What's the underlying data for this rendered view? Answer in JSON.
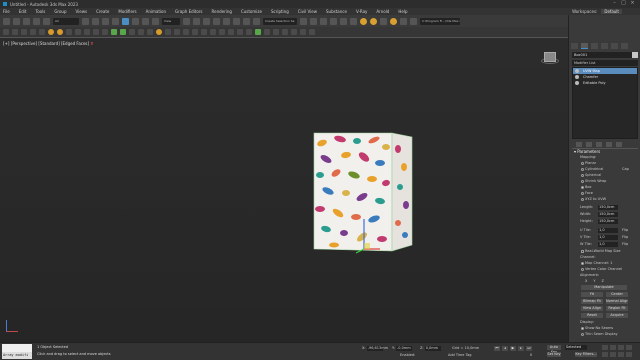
{
  "window": {
    "title": "Untitled - Autodesk 3ds Max 2023"
  },
  "menu": {
    "items": [
      "File",
      "Edit",
      "Tools",
      "Group",
      "Views",
      "Create",
      "Modifiers",
      "Animation",
      "Graph Editors",
      "Rendering",
      "Customize",
      "Scripting",
      "Civil View",
      "Substance",
      "V-Ray",
      "Arnold",
      "Help"
    ],
    "workspaces_label": "Workspaces:",
    "workspace_value": "Default"
  },
  "toolbar": {
    "filter_value": "All",
    "view_value": "View",
    "selection_set_placeholder": "Create Selection Se",
    "project_path": "C:\\Program Fi...\\3ds Max 2023"
  },
  "viewport": {
    "label_plus": "[+]",
    "label_view": "[Perspective]",
    "label_shading": "[Standard]",
    "label_style": "[Edged Faces]",
    "filter_icon": "funnel-icon"
  },
  "command_panel": {
    "object_name": "Box001",
    "modifier_list": "Modifier List",
    "stack": [
      {
        "label": "UVW Map",
        "selected": true
      },
      {
        "label": "Chamfer",
        "selected": false
      },
      {
        "label": "Editable Poly",
        "selected": false
      }
    ],
    "parameters_title": "Parameters",
    "mapping_label": "Mapping:",
    "mapping_options": [
      {
        "label": "Planar",
        "checked": false
      },
      {
        "label": "Cylindrical",
        "checked": false,
        "extra": "Cap"
      },
      {
        "label": "Spherical",
        "checked": false
      },
      {
        "label": "Shrink Wrap",
        "checked": false
      },
      {
        "label": "Box",
        "checked": true
      },
      {
        "label": "Face",
        "checked": false
      },
      {
        "label": "XYZ to UVW",
        "checked": false
      }
    ],
    "dimensions": [
      {
        "label": "Length:",
        "value": "150,0cm"
      },
      {
        "label": "Width:",
        "value": "150,0cm"
      },
      {
        "label": "Height:",
        "value": "150,0cm"
      }
    ],
    "tiles": [
      {
        "label": "U Tile:",
        "value": "1,0",
        "extra": "Flip"
      },
      {
        "label": "V Tile:",
        "value": "1,0",
        "extra": "Flip"
      },
      {
        "label": "W Tile:",
        "value": "1,0",
        "extra": "Flip"
      }
    ],
    "real_world_map_size": "Real-World Map Size",
    "channel_label": "Channel:",
    "map_channel_label": "Map Channel:",
    "map_channel_value": "1",
    "vertex_color_channel": "Vertex Color Channel",
    "alignment_label": "Alignment:",
    "align_axes": [
      "X",
      "Y",
      "Z"
    ],
    "align_buttons": {
      "manipulate": "Manipulate",
      "fit": "Fit",
      "center": "Center",
      "bitmap_fit": "Bitmap Fit",
      "normal_align": "Normal Align",
      "view_align": "View Align",
      "region_fit": "Region Fit",
      "reset": "Reset",
      "acquire": "Acquire"
    },
    "display_label": "Display:",
    "show_no_seams": "Show No Seams",
    "thin_seam_display": "Thin Seam Display"
  },
  "status": {
    "maxscript_line": "Array modifi",
    "selection_info": "1 Object Selected",
    "prompt": "Click and drag to select and move objects",
    "x_label": "X:",
    "x_value": "-96,613mm",
    "y_label": "Y:",
    "y_value": "-0,0mm",
    "z_label": "Z:",
    "z_value": "0,0mm",
    "grid": "Grid = 10,0mm",
    "enabled": "Enabled:",
    "add_time_tag": "Add Time Tag",
    "auto_key": "Auto Key",
    "selected_value": "Selected",
    "set_key": "Set Key",
    "key_filters": "Key Filters...",
    "frame": "0"
  },
  "colors": {
    "accent": "#4a8ec4",
    "selected_stack": "#5a8cbe",
    "viewport_bg": "#2a2a2a"
  }
}
